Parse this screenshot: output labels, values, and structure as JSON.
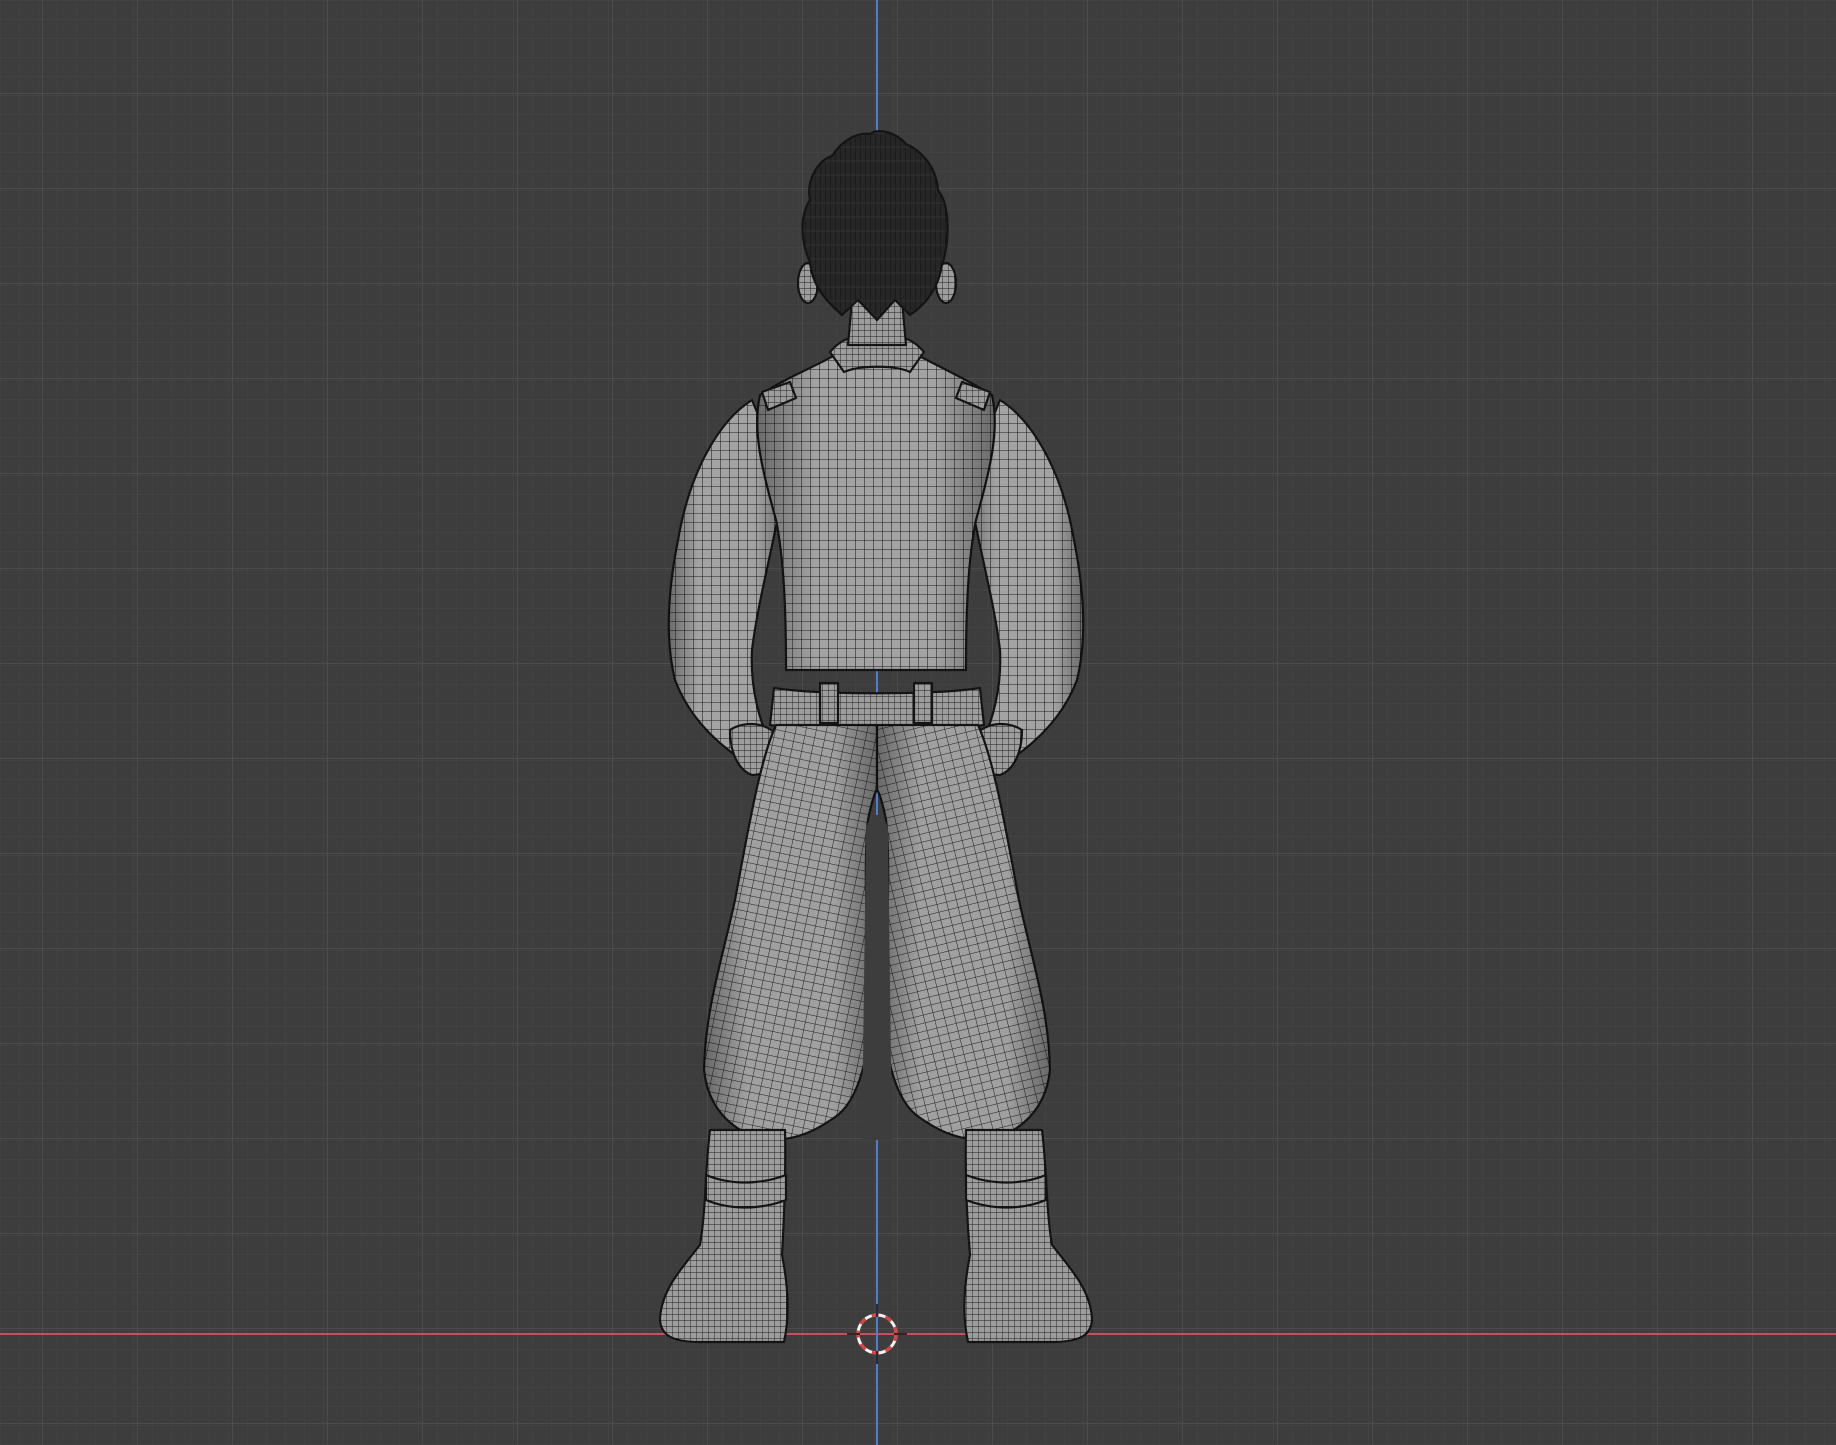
{
  "viewport": {
    "view": "back-orthographic",
    "grid": true,
    "colors": {
      "background": "#3d3d3d",
      "grid_minor": "#474747",
      "grid_major": "#525252",
      "axis_x": "#c8505e",
      "axis_z": "#4f7ecf",
      "mesh_fill": "#9a9a9a",
      "mesh_wire": "#1f1f1f",
      "hair": "#2a2a2a",
      "cursor_red": "#e04040",
      "cursor_white": "#f2f2f2"
    },
    "object": {
      "type": "character-mesh",
      "shading": "solid-with-wireframe"
    },
    "icons": {
      "cursor": "3d-cursor-icon"
    }
  }
}
